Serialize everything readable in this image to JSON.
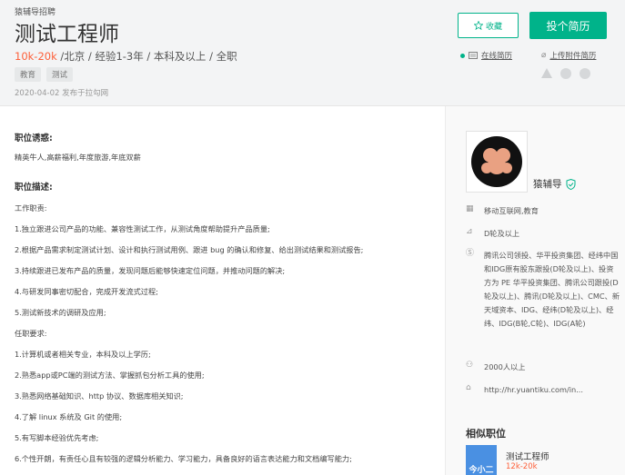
{
  "header": {
    "company": "猿辅导招聘",
    "title": "测试工程师",
    "salary": "10k-20k",
    "meta": " /北京 / 经验1-3年 / 本科及以上 / 全职",
    "tags": [
      "教育",
      "测试"
    ],
    "date": "2020-04-02  发布于拉勾网",
    "fav_label": "收藏",
    "apply_label": "投个简历",
    "online_resume": "在线简历",
    "upload_resume": "上传附件简历"
  },
  "main": {
    "perk_title": "职位诱惑:",
    "perk_text": "精英牛人,高薪福利,年度旅游,年底双薪",
    "desc_title": "职位描述:",
    "lines": [
      "工作职责:",
      "1.独立跟进公司产品的功能、兼容性测试工作，从测试角度帮助提升产品质量;",
      "2.根据产品需求制定测试计划、设计和执行测试用例、跟进 bug 的确认和修复、给出测试结果和测试报告;",
      "3.持续跟进已发布产品的质量，发现问题后能够快速定位问题，并推动问题的解决;",
      "4.与研发同事密切配合，完成开发流式过程;",
      "5.测试新技术的调研及应用;",
      "任职要求:",
      "1.计算机或者相关专业，本科及以上学历;",
      "2.熟悉app或PC端的测试方法、掌握抓包分析工具的使用;",
      "3.熟悉网络基础知识、http 协议、数据库相关知识;",
      "4.了解 linux 系统及 Git 的使用;",
      "5.有写脚本经验优先考虑;",
      "6.个性开朗，有责任心且有较强的逻辑分析能力、学习能力，具备良好的语言表达能力和文档编写能力;"
    ]
  },
  "sidebar": {
    "company_name": "猿辅导",
    "industry": "移动互联网,教育",
    "stage": "D轮及以上",
    "investors": "腾讯公司领投、华平投资集团、经纬中国和IDG原有股东跟投(D轮及以上)、投资方为 PE 华平投资集团、腾讯公司跟投(D轮及以上)、腾讯(D轮及以上)、CMC、新天域资本、IDG、经纬(D轮及以上)、经纬、IDG(B轮,C轮)、IDG(A轮)",
    "size": "2000人以上",
    "website": "http://hr.yuantiku.com/in...",
    "similar_title": "相似职位",
    "similar_name": "测试工程师",
    "similar_salary": "12k-20k",
    "similar_logo_text": "今小二"
  },
  "colors": {
    "accent": "#00b38a",
    "salary": "#fd5f39"
  }
}
